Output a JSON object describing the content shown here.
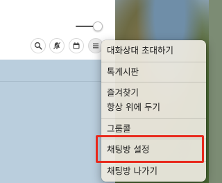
{
  "toolbar": {
    "buttons": [
      {
        "icon": "search-icon"
      },
      {
        "icon": "notification-off-icon"
      },
      {
        "icon": "calendar-icon"
      },
      {
        "icon": "menu-icon"
      }
    ],
    "zoom_slider": {
      "level": 0.75
    }
  },
  "context_menu": {
    "items": [
      {
        "label": "대화상대 초대하기"
      },
      {
        "label": "톡게시판"
      },
      {
        "label": "즐겨찾기"
      },
      {
        "label": "항상 위에 두기"
      },
      {
        "label": "그룹콜"
      },
      {
        "label": "채팅방 설정"
      },
      {
        "label": "채팅방 나가기"
      }
    ],
    "highlighted_item": "채팅방 설정"
  },
  "colors": {
    "chat_background": "#bacedd",
    "menu_background": "#ece9df",
    "highlight": "#e8291c"
  }
}
